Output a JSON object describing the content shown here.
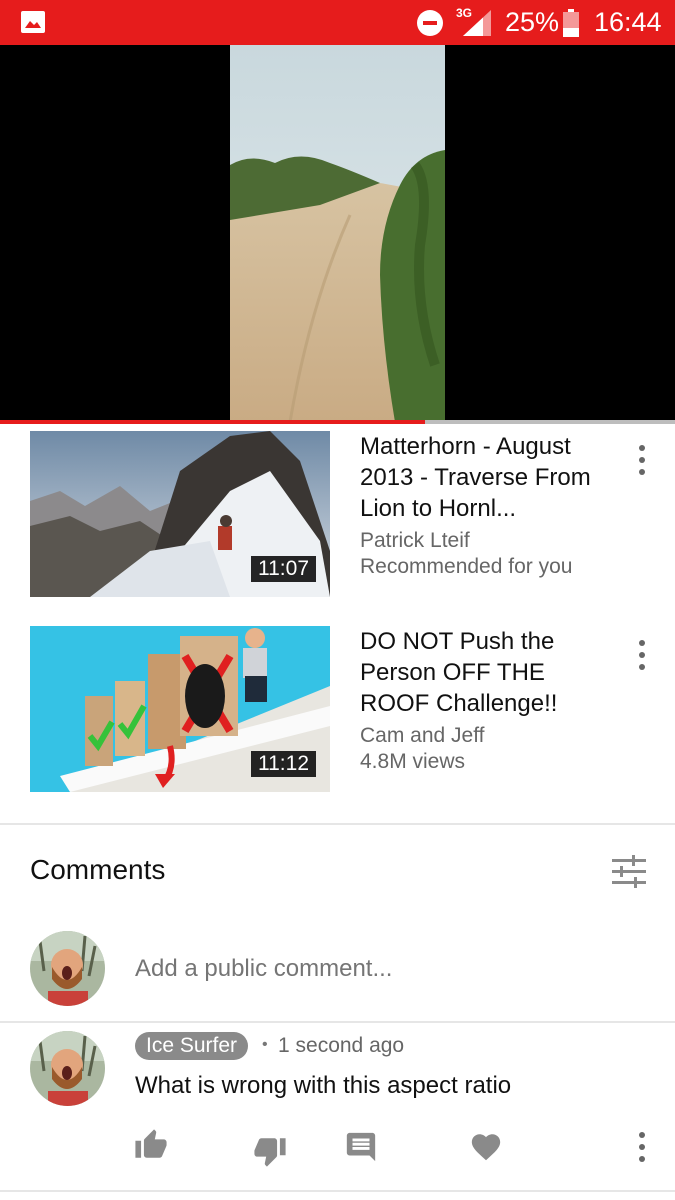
{
  "status_bar": {
    "network": "3G",
    "battery": "25%",
    "time": "16:44"
  },
  "player": {
    "progress_fraction": 0.63
  },
  "related": [
    {
      "title": "Matterhorn - August 2013 - Traverse From Lion to Hornl...",
      "channel": "Patrick Lteif",
      "meta": "Recommended for you",
      "duration": "11:07"
    },
    {
      "title": "DO NOT Push the Person OFF THE ROOF Challenge!!",
      "channel": "Cam and Jeff",
      "meta": "4.8M views",
      "duration": "11:12"
    }
  ],
  "comments": {
    "heading": "Comments",
    "input_placeholder": "Add a public comment...",
    "items": [
      {
        "author": "Ice Surfer",
        "separator": "•",
        "timestamp": "1 second ago",
        "text": "What is wrong with this aspect ratio"
      }
    ]
  },
  "icons": {
    "accent": "#e61c1c",
    "gallery": "gallery-icon",
    "dnd": "do-not-disturb-icon",
    "sort": "sort-filter-icon",
    "like": "thumb-up-icon",
    "dislike": "thumb-down-icon",
    "reply": "reply-icon",
    "heart": "heart-icon",
    "more": "more-vertical-icon"
  }
}
